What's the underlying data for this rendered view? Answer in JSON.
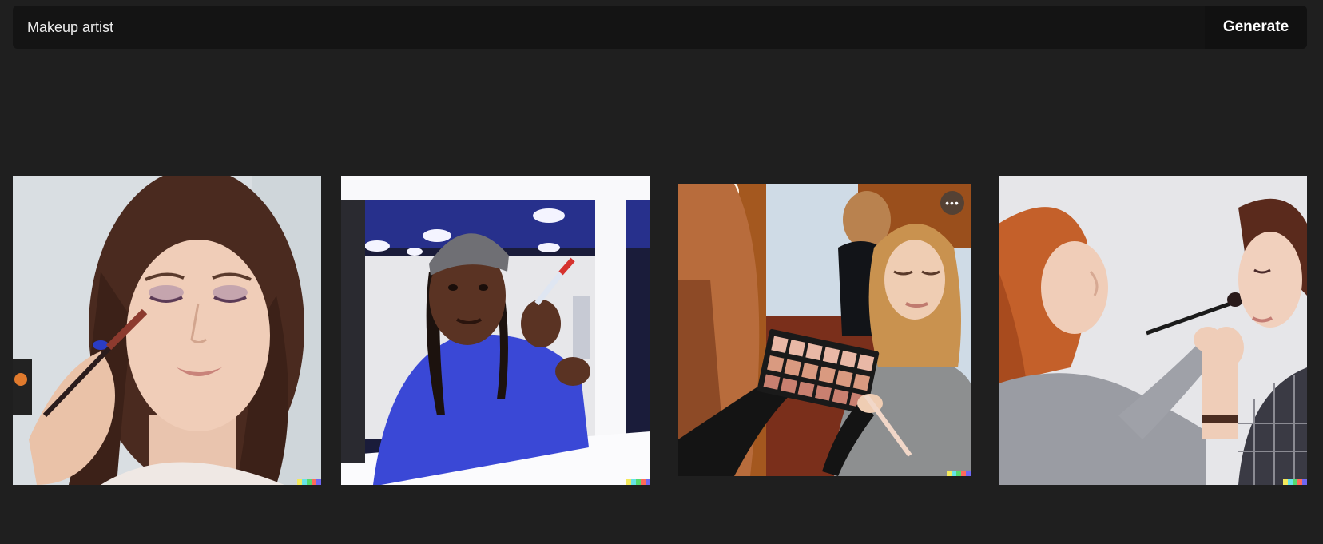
{
  "prompt": {
    "value": "Makeup artist",
    "generate_label": "Generate"
  },
  "results": {
    "more_label": "•••",
    "signature_colors": [
      "#f3e95b",
      "#66e3e8",
      "#56d96e",
      "#ff6a5a",
      "#6f67f2"
    ]
  }
}
